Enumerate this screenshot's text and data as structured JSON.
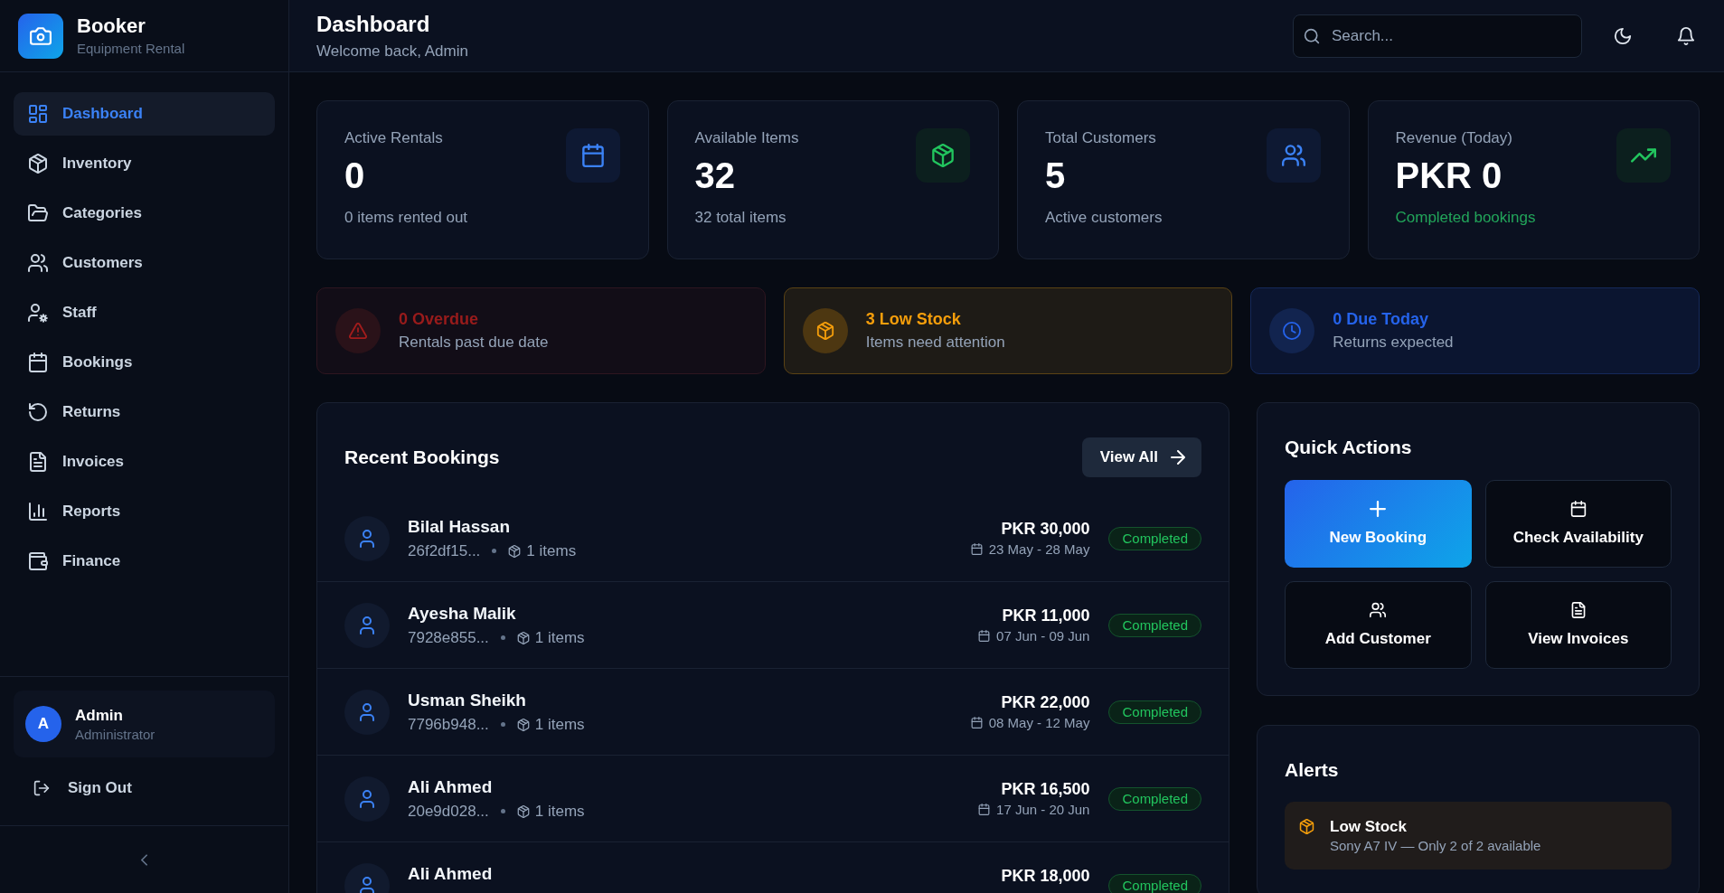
{
  "sidebar": {
    "brand": {
      "name": "Booker",
      "tagline": "Equipment Rental"
    },
    "nav": [
      {
        "label": "Dashboard",
        "selected": true
      },
      {
        "label": "Inventory",
        "selected": false
      },
      {
        "label": "Categories",
        "selected": false
      },
      {
        "label": "Customers",
        "selected": false
      },
      {
        "label": "Staff",
        "selected": false
      },
      {
        "label": "Bookings",
        "selected": false
      },
      {
        "label": "Returns",
        "selected": false
      },
      {
        "label": "Invoices",
        "selected": false
      },
      {
        "label": "Reports",
        "selected": false
      },
      {
        "label": "Finance",
        "selected": false
      }
    ],
    "user": {
      "initial": "A",
      "name": "Admin",
      "role": "Administrator"
    },
    "sign_out": "Sign Out"
  },
  "header": {
    "title": "Dashboard",
    "subtitle": "Welcome back, Admin",
    "search": {
      "placeholder": "Search..."
    }
  },
  "stats": [
    {
      "kind": "rentals",
      "label": "Active Rentals",
      "value": "0",
      "note": "0 items rented out"
    },
    {
      "kind": "items",
      "label": "Available Items",
      "value": "32",
      "note": "32 total items"
    },
    {
      "kind": "customers",
      "label": "Total Customers",
      "value": "5",
      "note": "Active customers"
    },
    {
      "kind": "revenue",
      "label": "Revenue (Today)",
      "value": "PKR 0",
      "note": "Completed bookings"
    }
  ],
  "banners": [
    {
      "kind": "overdue",
      "title": "0 Overdue",
      "text": "Rentals past due date"
    },
    {
      "kind": "low_stock",
      "title": "3 Low Stock",
      "text": "Items need attention"
    },
    {
      "kind": "due_today",
      "title": "0 Due Today",
      "text": "Returns expected"
    }
  ],
  "recent_bookings": {
    "title": "Recent Bookings",
    "view_all": "View All",
    "rows": [
      {
        "customer": "Bilal Hassan",
        "ref": "26f2df15...",
        "items": "1 items",
        "amount": "PKR 30,000",
        "dates": "23 May - 28 May",
        "status": "Completed"
      },
      {
        "customer": "Ayesha Malik",
        "ref": "7928e855...",
        "items": "1 items",
        "amount": "PKR 11,000",
        "dates": "07 Jun - 09 Jun",
        "status": "Completed"
      },
      {
        "customer": "Usman Sheikh",
        "ref": "7796b948...",
        "items": "1 items",
        "amount": "PKR 22,000",
        "dates": "08 May - 12 May",
        "status": "Completed"
      },
      {
        "customer": "Ali Ahmed",
        "ref": "20e9d028...",
        "items": "1 items",
        "amount": "PKR 16,500",
        "dates": "17 Jun - 20 Jun",
        "status": "Completed"
      },
      {
        "customer": "Ali Ahmed",
        "amount": "PKR 18,000",
        "status": "Completed"
      }
    ]
  },
  "quick_actions": {
    "title": "Quick Actions",
    "actions": [
      {
        "kind": "primary",
        "label": "New Booking"
      },
      {
        "kind": "secondary",
        "label": "Check Availability"
      },
      {
        "kind": "secondary",
        "label": "Add Customer"
      },
      {
        "kind": "secondary",
        "label": "View Invoices"
      }
    ]
  },
  "alerts": {
    "title": "Alerts",
    "items": [
      {
        "kind": "low_stock",
        "title": "Low Stock",
        "text": "Sony A7 IV — Only 2 of 2 available"
      }
    ]
  }
}
